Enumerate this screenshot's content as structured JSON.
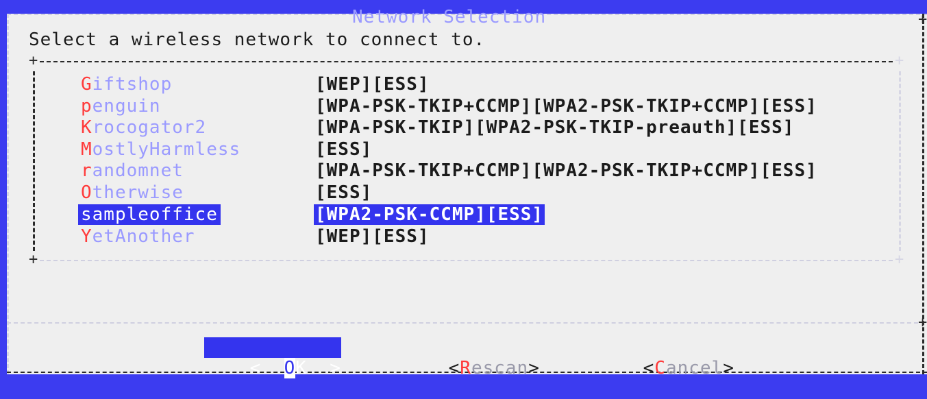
{
  "dialog": {
    "title": "Network Selection",
    "prompt": "Select a wireless network to connect to."
  },
  "networks": [
    {
      "hotkey": "G",
      "rest": "iftshop",
      "flags": "[WEP][ESS]",
      "selected": false
    },
    {
      "hotkey": "p",
      "rest": "enguin",
      "flags": "[WPA-PSK-TKIP+CCMP][WPA2-PSK-TKIP+CCMP][ESS]",
      "selected": false
    },
    {
      "hotkey": "K",
      "rest": "rocogator2",
      "flags": "[WPA-PSK-TKIP][WPA2-PSK-TKIP-preauth][ESS]",
      "selected": false
    },
    {
      "hotkey": "M",
      "rest": "ostlyHarmless",
      "flags": "[ESS]",
      "selected": false
    },
    {
      "hotkey": "r",
      "rest": "andomnet",
      "flags": "[WPA-PSK-TKIP+CCMP][WPA2-PSK-TKIP+CCMP][ESS]",
      "selected": false
    },
    {
      "hotkey": "O",
      "rest": "therwise",
      "flags": "[ESS]",
      "selected": false
    },
    {
      "hotkey": "s",
      "rest": "ampleoffice",
      "flags": "[WPA2-PSK-CCMP][ESS]",
      "selected": true
    },
    {
      "hotkey": "Y",
      "rest": "etAnother",
      "flags": "[WEP][ESS]",
      "selected": false
    }
  ],
  "buttons": {
    "ok": {
      "left": "<  ",
      "hotkey": "O",
      "rest": "K",
      "right": "  >"
    },
    "rescan": {
      "left": "<",
      "hotkey": "R",
      "rest": "escan",
      "right": ">"
    },
    "cancel": {
      "left": "<",
      "hotkey": "C",
      "rest": "ancel",
      "right": ">"
    }
  },
  "colors": {
    "screen_background": "#3c3cf0",
    "dialog_background": "#efefef",
    "title": "#9a9aff",
    "hotkey": "#ff3a3a",
    "selection": "#3434ee"
  }
}
